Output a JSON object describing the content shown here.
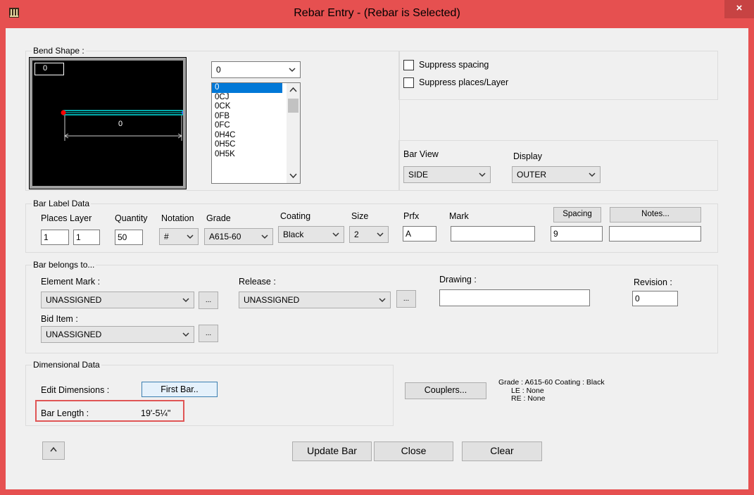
{
  "window": {
    "title": "Rebar Entry - (Rebar is Selected)",
    "close": "×",
    "accent": "#e65050"
  },
  "bend_shape": {
    "group_title": "Bend Shape :",
    "selected": "0",
    "canvas_tag": "0",
    "dim_label": "0",
    "list": [
      "0",
      "0CJ",
      "0CK",
      "0FB",
      "0FC",
      "0H4C",
      "0H5C",
      "0H5K"
    ],
    "suppress_spacing": "Suppress spacing",
    "suppress_places": "Suppress places/Layer",
    "bar_view_label": "Bar View",
    "bar_view_value": "SIDE",
    "display_label": "Display",
    "display_value": "OUTER"
  },
  "label_data": {
    "group_title": "Bar Label Data",
    "places_layer": "Places Layer",
    "quantity": "Quantity",
    "notation": "Notation",
    "grade": "Grade",
    "coating": "Coating",
    "size": "Size",
    "prfx": "Prfx",
    "mark": "Mark",
    "spacing_btn": "Spacing",
    "notes_btn": "Notes...",
    "places_val": "1",
    "layer_val": "1",
    "quantity_val": "50",
    "notation_val": "#",
    "grade_val": "A615-60",
    "coating_val": "Black",
    "size_val": "2",
    "prfx_val": "A",
    "mark_val": "",
    "spacing_val": "9",
    "notes_val": ""
  },
  "belongs": {
    "group_title": "Bar belongs to...",
    "element_mark": "Element Mark :",
    "element_val": "UNASSIGNED",
    "release": "Release :",
    "release_val": "UNASSIGNED",
    "drawing": "Drawing :",
    "drawing_val": "",
    "revision": "Revision :",
    "revision_val": "0",
    "bid_item": "Bid Item :",
    "bid_val": "UNASSIGNED",
    "ellipsis": "..."
  },
  "dimensional": {
    "group_title": "Dimensional Data",
    "edit_dims": "Edit Dimensions :",
    "first_bar": "First Bar..",
    "bar_length_label": "Bar Length :",
    "bar_length_val": "19'-5¼\"",
    "couplers": "Couplers...",
    "info_line1": "Grade : A615-60 Coating : Black",
    "info_line2": "LE : None",
    "info_line3": "RE : None"
  },
  "footer": {
    "collapse": "^",
    "update": "Update Bar",
    "close": "Close",
    "clear": "Clear"
  }
}
